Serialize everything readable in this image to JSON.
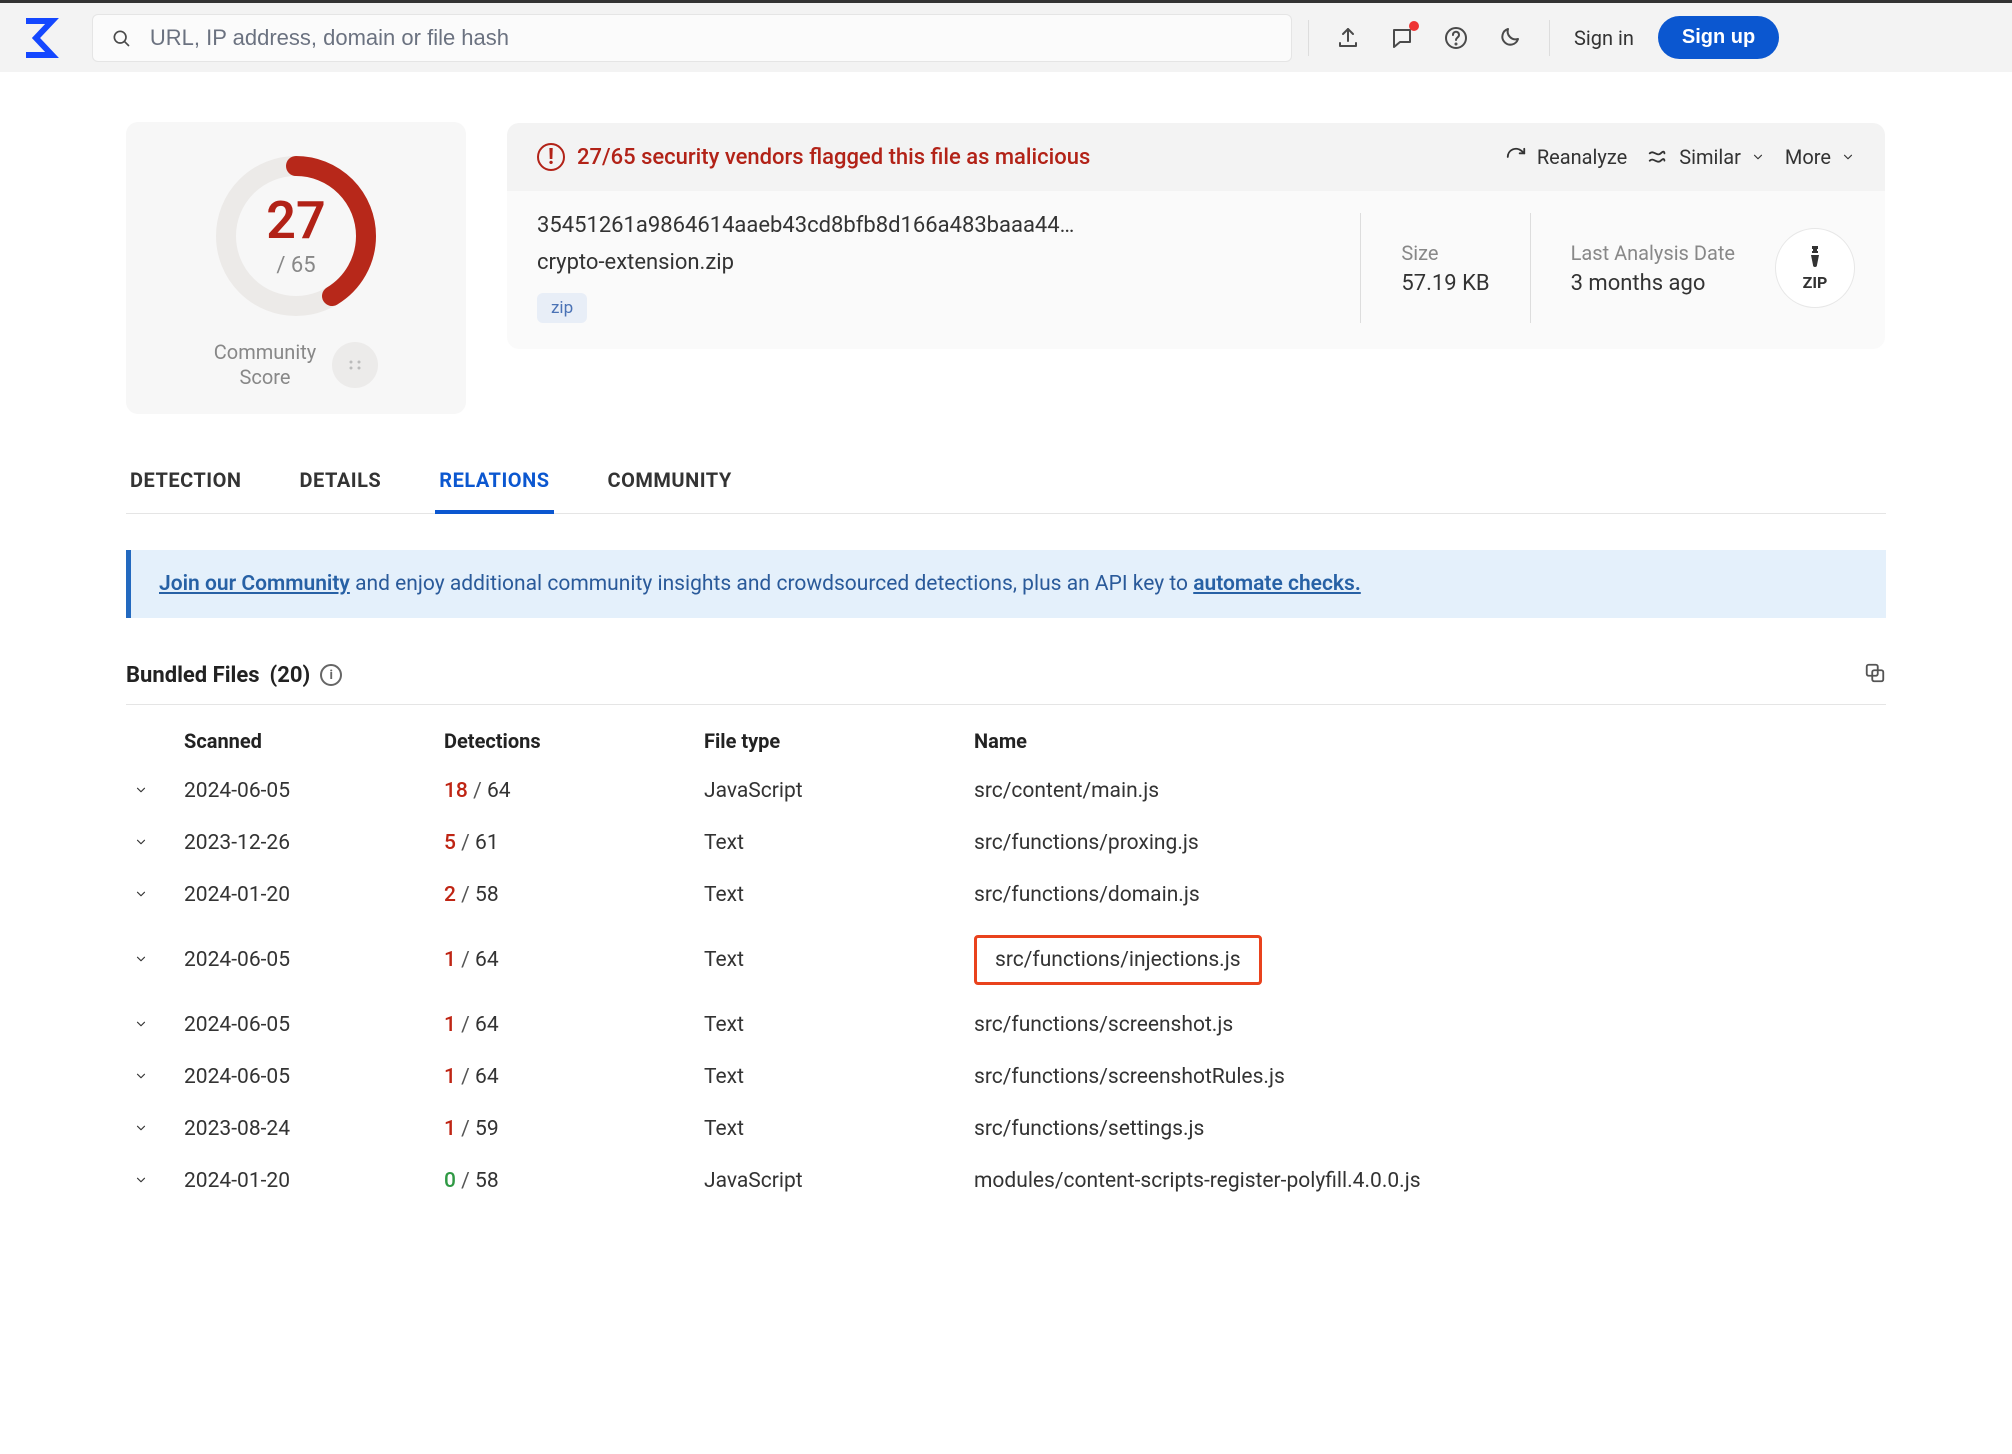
{
  "search": {
    "placeholder": "URL, IP address, domain or file hash"
  },
  "nav": {
    "signin": "Sign in",
    "signup": "Sign up"
  },
  "score": {
    "numerator": "27",
    "denominator": "/ 65",
    "community_label_l1": "Community",
    "community_label_l2": "Score"
  },
  "header": {
    "flag_text": "27/65 security vendors flagged this file as malicious",
    "reanalyze": "Reanalyze",
    "similar": "Similar",
    "more": "More"
  },
  "file": {
    "hash": "35451261a9864614aaeb43cd8bfb8d166a483baaa44…",
    "name": "crypto-extension.zip",
    "tag": "zip",
    "size_label": "Size",
    "size_value": "57.19 KB",
    "date_label": "Last Analysis Date",
    "date_value": "3 months ago",
    "badge": "ZIP"
  },
  "tabs": {
    "t0": "DETECTION",
    "t1": "DETAILS",
    "t2": "RELATIONS",
    "t3": "COMMUNITY"
  },
  "banner": {
    "link1": "Join our Community",
    "mid": " and enjoy additional community insights and crowdsourced detections, plus an API key to ",
    "link2": "automate checks."
  },
  "section": {
    "title": "Bundled Files",
    "count": "(20)"
  },
  "table": {
    "h_scanned": "Scanned",
    "h_det": "Detections",
    "h_type": "File type",
    "h_name": "Name"
  },
  "rows": [
    {
      "scanned": "2024-06-05",
      "hit": "18",
      "total": "64",
      "hit_class": "red",
      "type": "JavaScript",
      "name": "src/content/main.js",
      "highlight": false
    },
    {
      "scanned": "2023-12-26",
      "hit": "5",
      "total": "61",
      "hit_class": "red",
      "type": "Text",
      "name": "src/functions/proxing.js",
      "highlight": false
    },
    {
      "scanned": "2024-01-20",
      "hit": "2",
      "total": "58",
      "hit_class": "red",
      "type": "Text",
      "name": "src/functions/domain.js",
      "highlight": false
    },
    {
      "scanned": "2024-06-05",
      "hit": "1",
      "total": "64",
      "hit_class": "red",
      "type": "Text",
      "name": "src/functions/injections.js",
      "highlight": true
    },
    {
      "scanned": "2024-06-05",
      "hit": "1",
      "total": "64",
      "hit_class": "red",
      "type": "Text",
      "name": "src/functions/screenshot.js",
      "highlight": false
    },
    {
      "scanned": "2024-06-05",
      "hit": "1",
      "total": "64",
      "hit_class": "red",
      "type": "Text",
      "name": "src/functions/screenshotRules.js",
      "highlight": false
    },
    {
      "scanned": "2023-08-24",
      "hit": "1",
      "total": "59",
      "hit_class": "red",
      "type": "Text",
      "name": "src/functions/settings.js",
      "highlight": false
    },
    {
      "scanned": "2024-01-20",
      "hit": "0",
      "total": "58",
      "hit_class": "green",
      "type": "JavaScript",
      "name": "modules/content-scripts-register-polyfill.4.0.0.js",
      "highlight": false
    }
  ]
}
